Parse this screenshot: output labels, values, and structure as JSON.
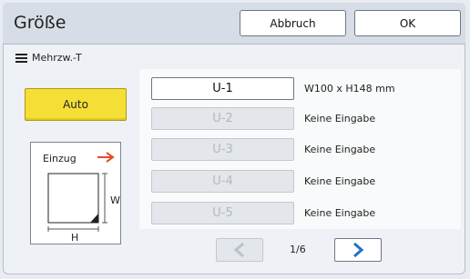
{
  "header": {
    "title": "Größe",
    "cancel_label": "Abbruch",
    "ok_label": "OK"
  },
  "mode": {
    "label": "Mehrzw.-T",
    "icon": "list-icon"
  },
  "auto_label": "Auto",
  "diagram": {
    "feed_label": "Einzug",
    "width_label": "W",
    "height_label": "H",
    "arrow_color": "#e8492a"
  },
  "sizes": [
    {
      "label": "U-1",
      "desc": "W100 x H148 mm",
      "enabled": true
    },
    {
      "label": "U-2",
      "desc": "Keine Eingabe",
      "enabled": false
    },
    {
      "label": "U-3",
      "desc": "Keine Eingabe",
      "enabled": false
    },
    {
      "label": "U-4",
      "desc": "Keine Eingabe",
      "enabled": false
    },
    {
      "label": "U-5",
      "desc": "Keine Eingabe",
      "enabled": false
    }
  ],
  "pagination": {
    "current": "1/6"
  },
  "colors": {
    "accent_yellow": "#f5df37",
    "nav_arrow": "#1f73c8",
    "nav_arrow_disabled": "#b9c2cc"
  }
}
